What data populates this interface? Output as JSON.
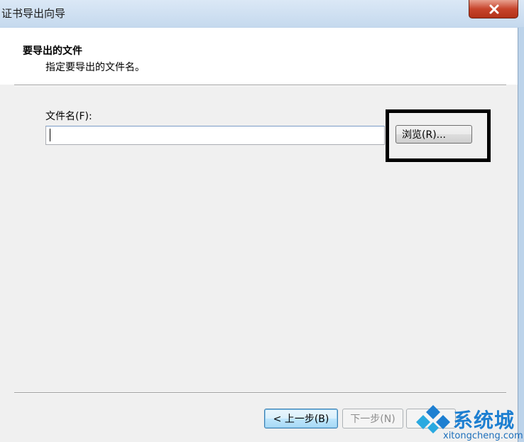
{
  "window": {
    "title": "证书导出向导",
    "close_icon": "close-x-icon"
  },
  "header": {
    "title": "要导出的文件",
    "subtitle": "指定要导出的文件名。"
  },
  "form": {
    "filename_label": "文件名(F):",
    "filename_value": "",
    "browse_label": "浏览(R)..."
  },
  "footer": {
    "back_label": "< 上一步(B)",
    "next_label": "下一步(N)"
  },
  "watermark": {
    "brand": "系统城",
    "url": "xitongcheng.com",
    "logo_icon": "xitongcheng-logo-icon",
    "colors": [
      "#1d7fd1",
      "#2aa9e0"
    ]
  },
  "colors": {
    "titlebar": "#c5d9ee",
    "close_button": "#c7452c",
    "dialog_bg": "#f0f0f0",
    "highlight_box": "#000000"
  }
}
